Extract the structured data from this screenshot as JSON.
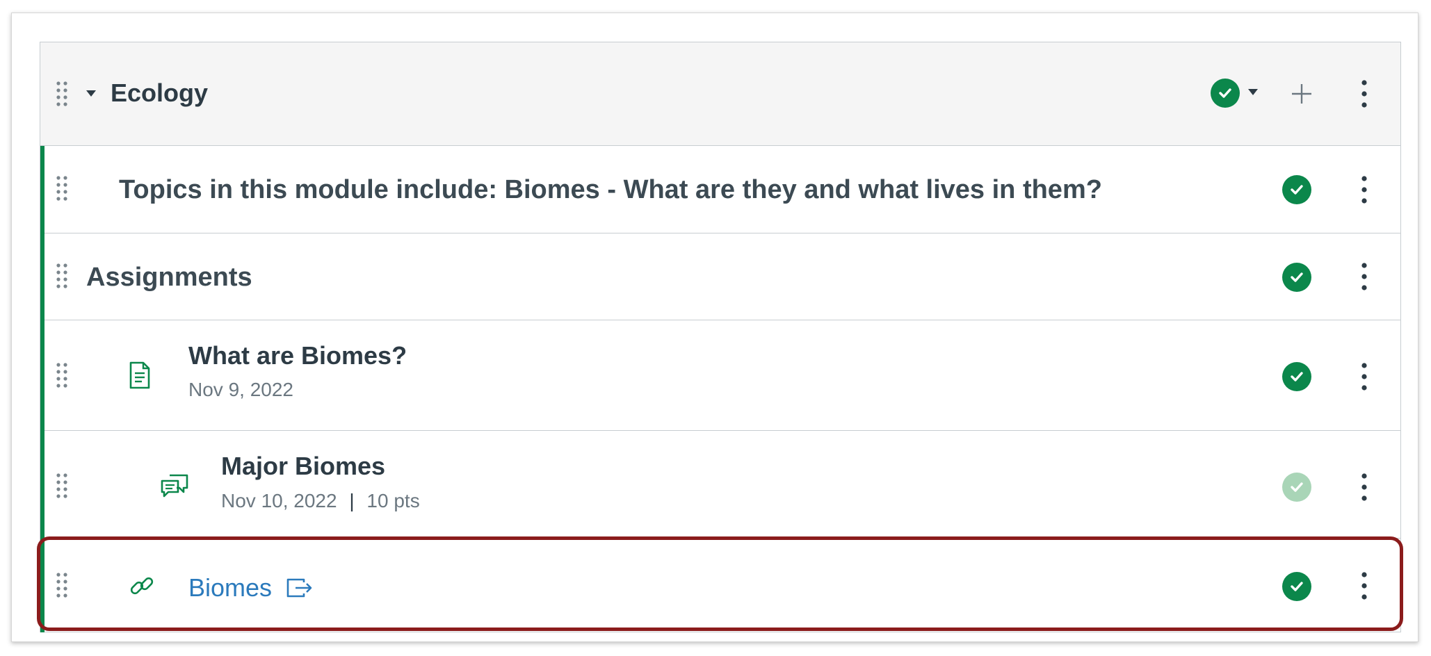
{
  "module": {
    "title": "Ecology",
    "collapse_caret": "caret-down-icon",
    "publish_status": "published",
    "add_icon": "plus-icon",
    "options_icon": "kebab-icon"
  },
  "items": [
    {
      "type": "text-header",
      "title": "Topics in this module include: Biomes - What are they and what lives in them?",
      "status": "published"
    },
    {
      "type": "text-header",
      "title": "Assignments",
      "status": "published"
    },
    {
      "type": "page",
      "icon": "document-icon",
      "title": "What are Biomes?",
      "date": "Nov 9, 2022",
      "status": "published"
    },
    {
      "type": "discussion",
      "icon": "discussion-icon",
      "title": "Major Biomes",
      "date": "Nov 10, 2022",
      "separator": "|",
      "points": "10 pts",
      "status": "unpublished"
    },
    {
      "type": "external-link",
      "icon": "link-icon",
      "title": "Biomes",
      "external_icon": "external-link-icon",
      "status": "published"
    }
  ],
  "colors": {
    "published": "#0b874b",
    "unpublished": "#a9d5b7",
    "link": "#2b7abc",
    "highlight": "#8b1c1c"
  }
}
